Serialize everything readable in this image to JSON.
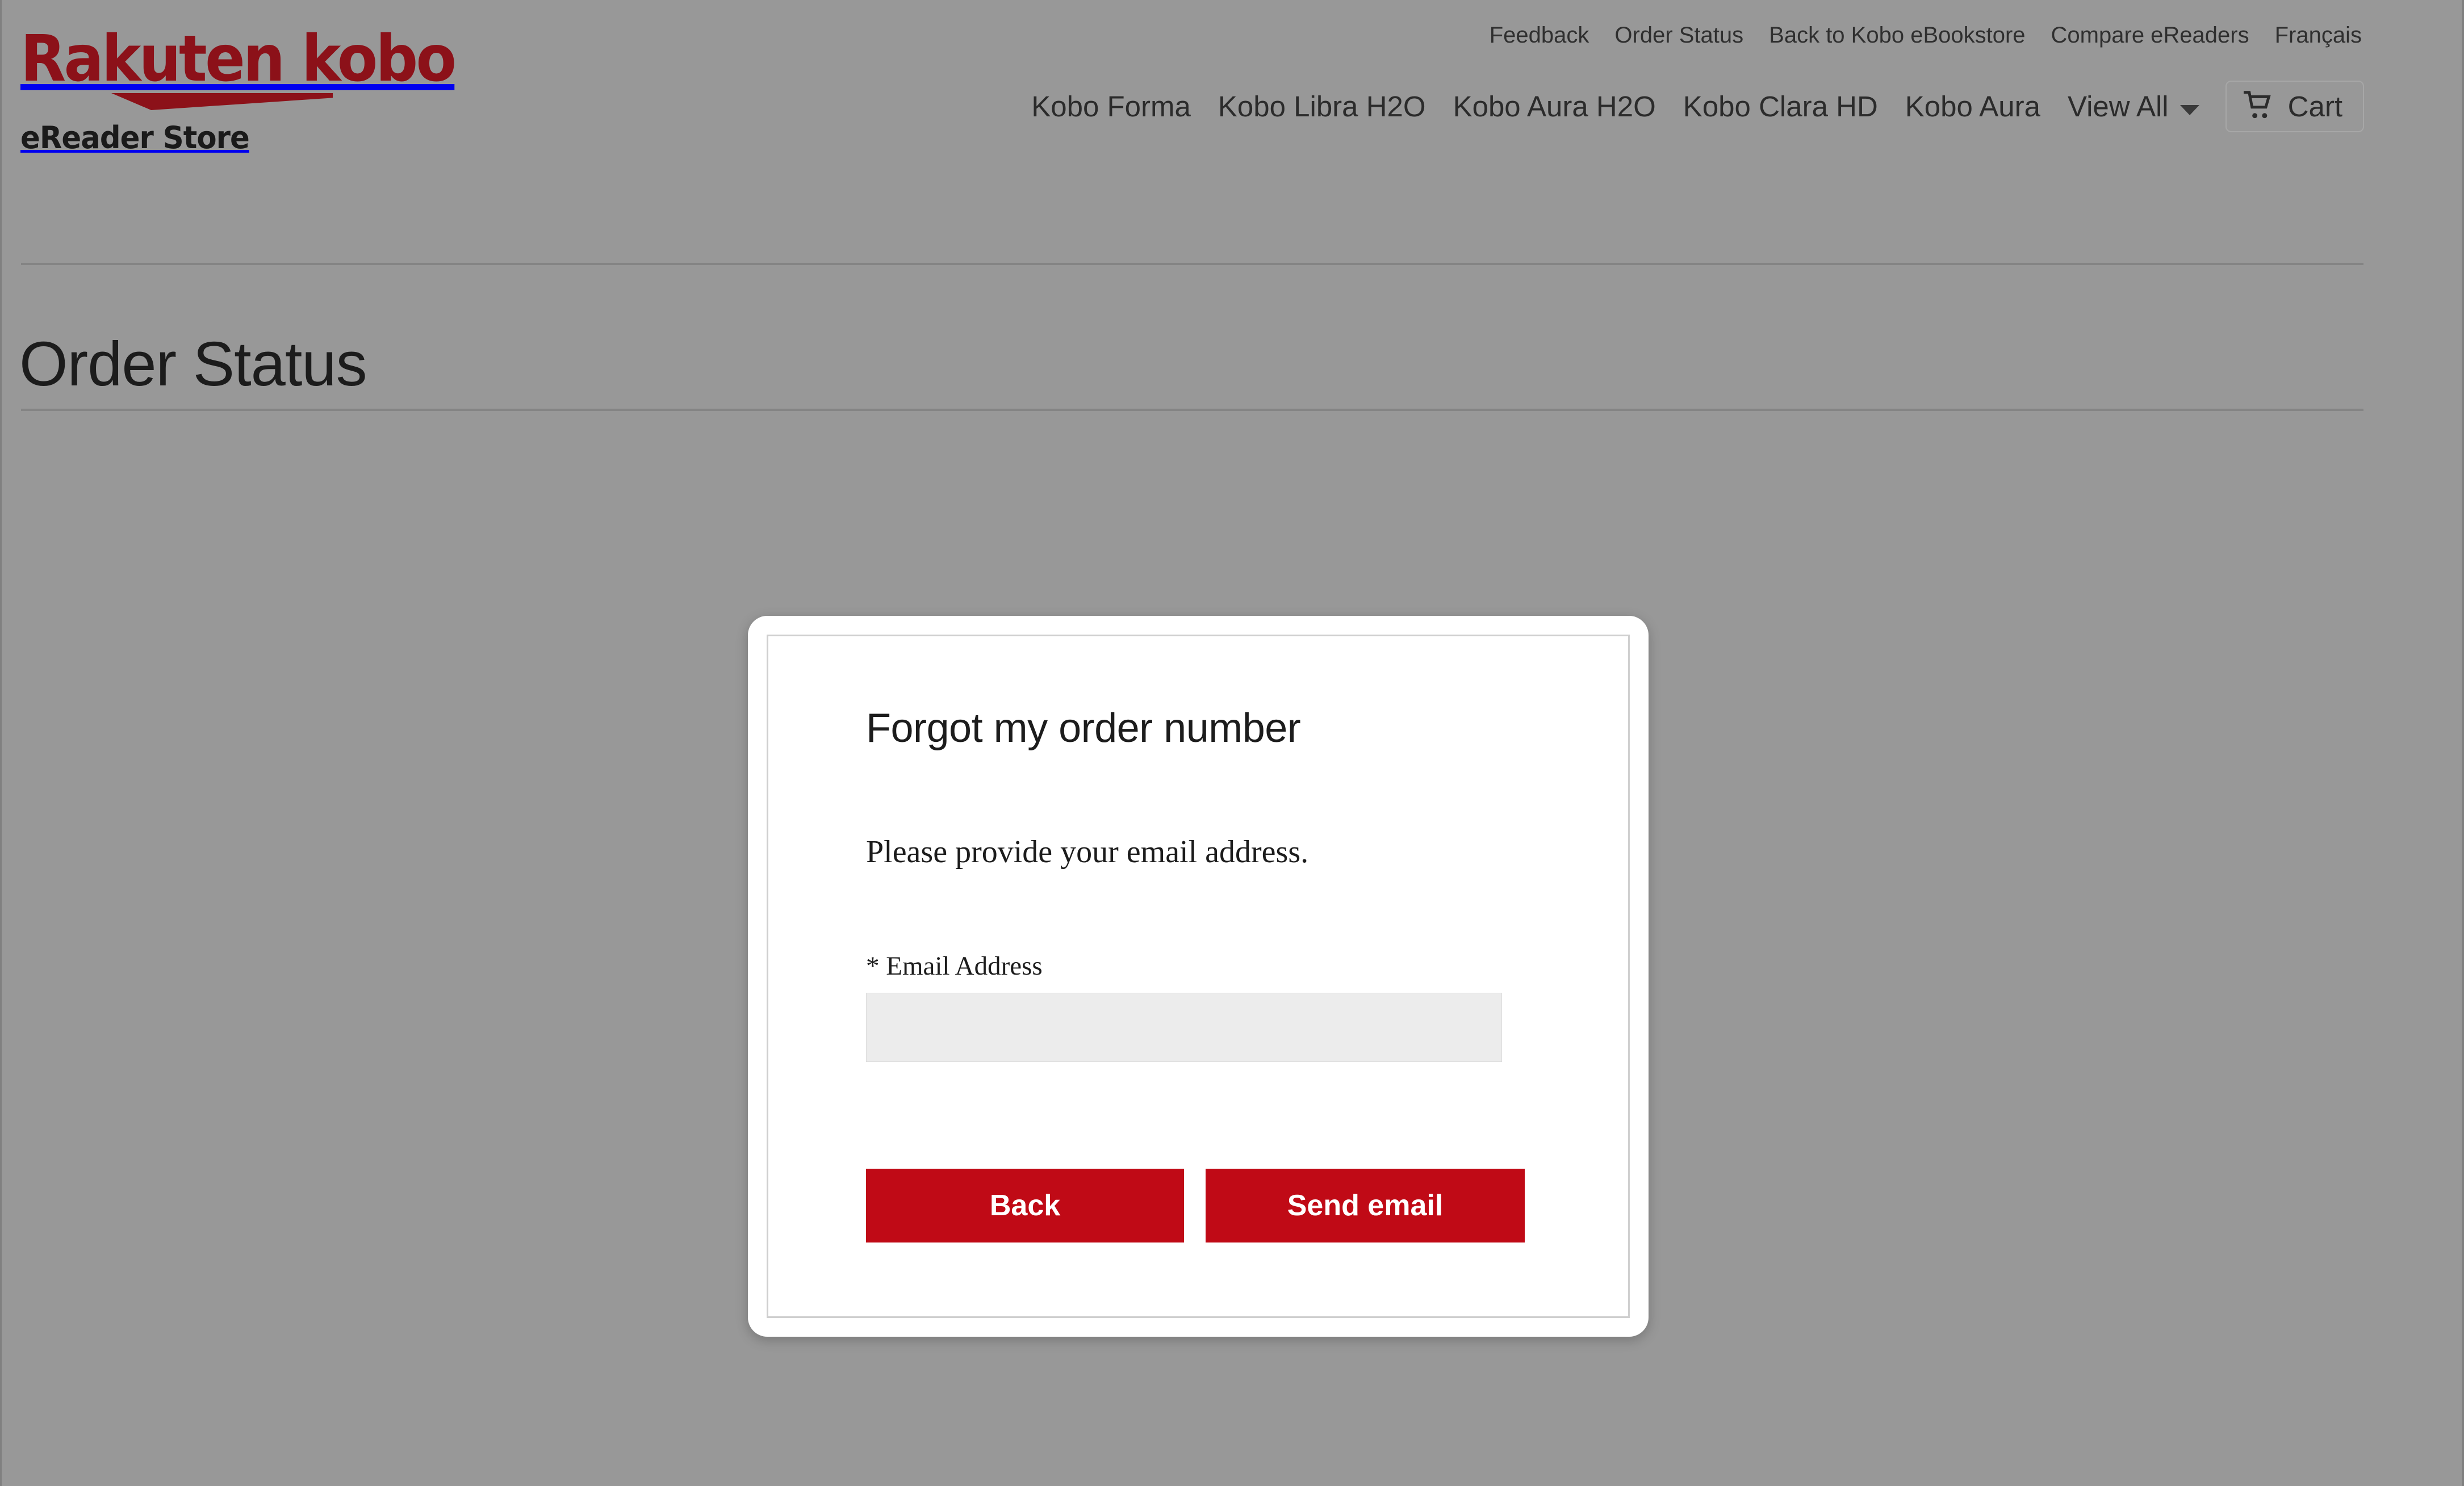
{
  "brand": {
    "logo_line1": "Rakuten kobo",
    "logo_line2": "eReader Store",
    "logo_color": "#8c1119"
  },
  "header": {
    "utility_nav": [
      {
        "label": "Feedback"
      },
      {
        "label": "Order Status"
      },
      {
        "label": "Back to Kobo eBookstore"
      },
      {
        "label": "Compare eReaders"
      },
      {
        "label": "Français"
      }
    ],
    "product_nav": [
      {
        "label": "Kobo Forma"
      },
      {
        "label": "Kobo Libra H2O"
      },
      {
        "label": "Kobo Aura H2O"
      },
      {
        "label": "Kobo Clara HD"
      },
      {
        "label": "Kobo Aura"
      }
    ],
    "view_all_label": "View All",
    "cart_label": "Cart"
  },
  "page": {
    "title": "Order Status"
  },
  "modal": {
    "title": "Forgot my order number",
    "instruction": "Please provide your email address.",
    "email_label": "* Email Address",
    "email_value": "",
    "email_placeholder": "",
    "back_label": "Back",
    "send_label": "Send email",
    "button_color": "#c00a16"
  }
}
